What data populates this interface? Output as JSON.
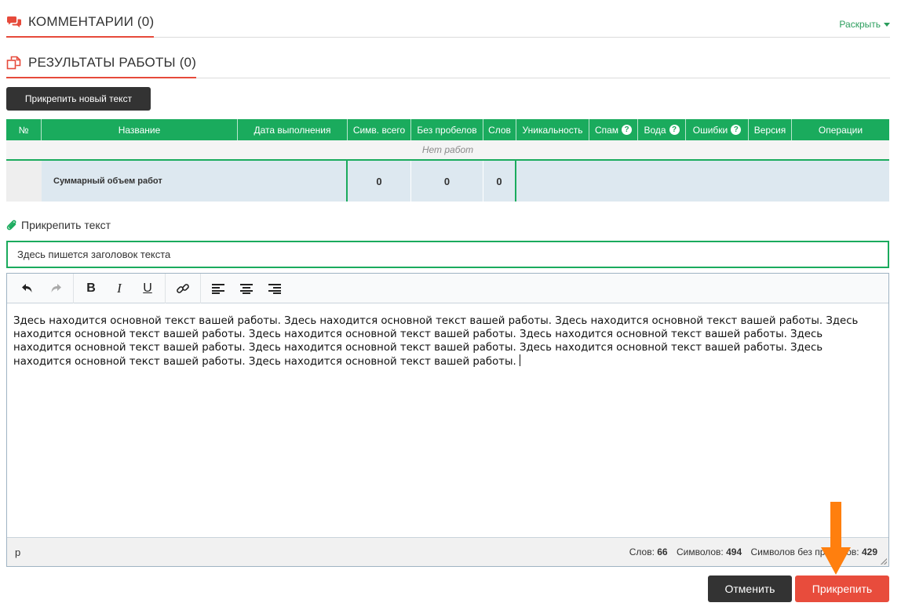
{
  "comments": {
    "title": "КОММЕНТАРИИ (0)",
    "expand_link": "Раскрыть"
  },
  "results": {
    "title": "РЕЗУЛЬТАТЫ РАБОТЫ (0)",
    "attach_new_button": "Прикрепить новый текст"
  },
  "table": {
    "headers": {
      "no": "№",
      "name": "Название",
      "date": "Дата выполнения",
      "chars_total": "Симв. всего",
      "no_spaces": "Без пробелов",
      "words": "Слов",
      "uniqueness": "Уникальность",
      "spam": "Спам",
      "water": "Вода",
      "errors": "Ошибки",
      "version": "Версия",
      "operations": "Операции"
    },
    "empty_text": "Нет работ",
    "summary": {
      "label": "Суммарный объем работ",
      "chars_total": "0",
      "no_spaces": "0",
      "words": "0"
    }
  },
  "attach": {
    "label": "Прикрепить текст",
    "title_value": "Здесь пишется заголовок текста"
  },
  "editor": {
    "content": "Здесь находится основной текст вашей работы. Здесь находится основной текст вашей работы. Здесь находится основной текст вашей работы. Здесь находится основной текст вашей работы. Здесь находится основной текст вашей работы. Здесь находится основной текст вашей работы. Здесь находится основной текст вашей работы. Здесь находится основной текст вашей работы. Здесь находится основной текст вашей работы. Здесь находится основной текст вашей работы. Здесь находится основной текст вашей работы.",
    "status": {
      "path": "p",
      "words_label": "Слов:",
      "words": "66",
      "chars_label": "Символов:",
      "chars": "494",
      "chars_nospace_label": "Символов без пробелов:",
      "chars_nospace": "429"
    },
    "toolbar_icons": [
      "undo-icon",
      "redo-icon",
      "bold-icon",
      "italic-icon",
      "underline-icon",
      "link-icon",
      "align-left-icon",
      "align-center-icon",
      "align-right-icon"
    ]
  },
  "actions": {
    "cancel": "Отменить",
    "attach": "Прикрепить"
  },
  "colors": {
    "accent_green": "#1aab5d",
    "accent_red": "#e84c3c",
    "dark": "#333333",
    "arrow": "#ff7f0e"
  }
}
